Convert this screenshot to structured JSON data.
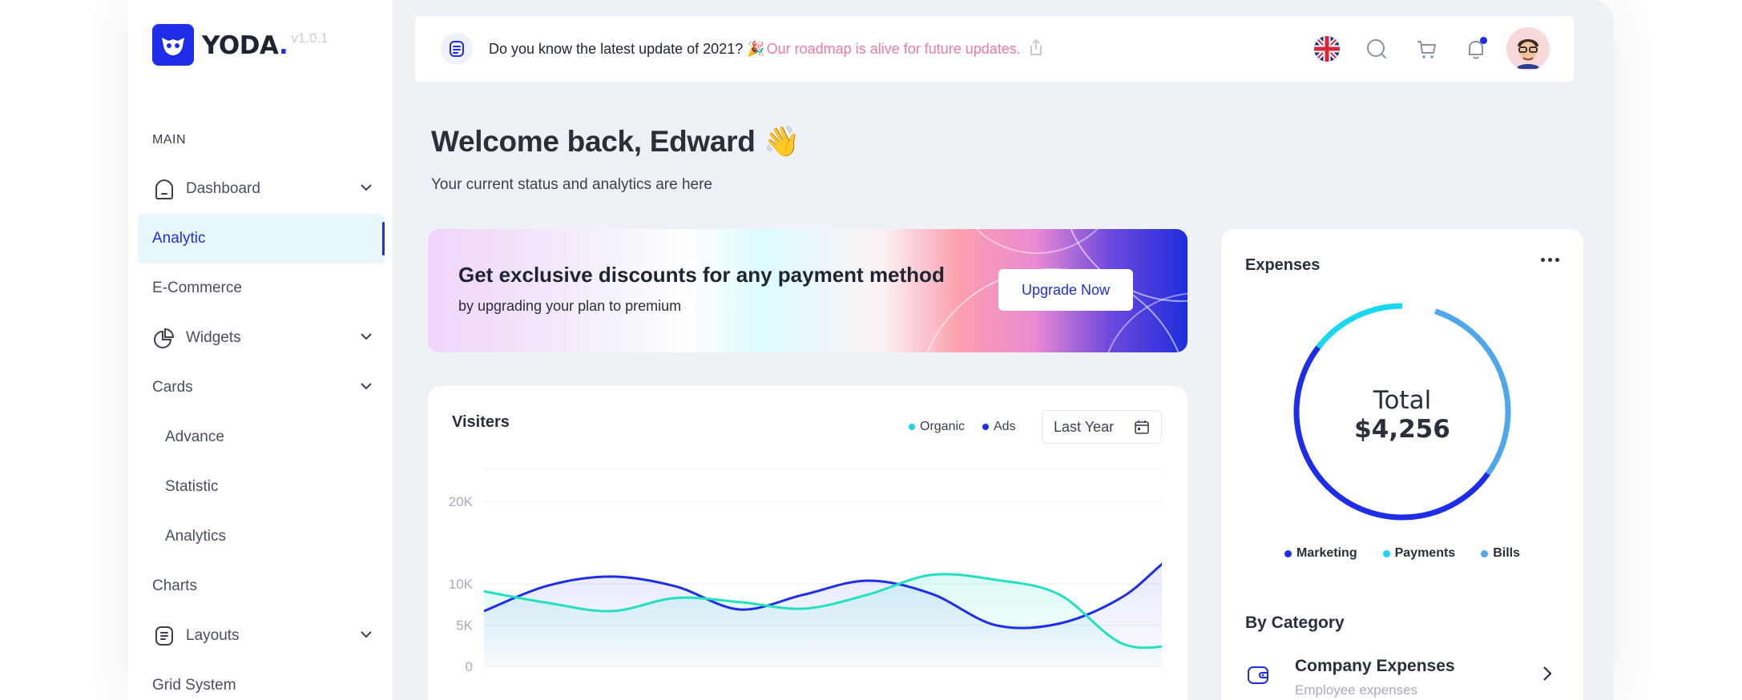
{
  "app": {
    "name": "YODA",
    "name_dot": ".",
    "version": "v1.0.1"
  },
  "sidebar": {
    "section_title": "MAIN",
    "items": [
      {
        "label": "Dashboard",
        "icon": "home-icon",
        "has_chevron": true
      },
      {
        "label": "Analytic",
        "active": true
      },
      {
        "label": "E-Commerce"
      },
      {
        "label": "Widgets",
        "icon": "pie-chart-icon",
        "has_chevron": true
      },
      {
        "label": "Cards",
        "has_chevron": true
      },
      {
        "label": "Advance",
        "sub": true
      },
      {
        "label": "Statistic",
        "sub": true
      },
      {
        "label": "Analytics",
        "sub": true
      },
      {
        "label": "Charts"
      },
      {
        "label": "Layouts",
        "icon": "layout-icon",
        "has_chevron": true
      },
      {
        "label": "Grid System"
      }
    ]
  },
  "topbar": {
    "news_text": "Do you know the latest update of 2021? 🎉",
    "news_link": "Our roadmap is alive for future updates.",
    "icons": [
      "uk-flag-icon",
      "search-icon",
      "cart-icon",
      "bell-icon"
    ],
    "notification_color": "#1e2ee8"
  },
  "welcome": {
    "title": "Welcome back, Edward 👋",
    "subtitle": "Your current status and analytics are here"
  },
  "promo": {
    "title": "Get exclusive discounts for any payment method",
    "subtitle": "by upgrading your plan to premium",
    "button": "Upgrade Now"
  },
  "visitors": {
    "title": "Visiters",
    "legend": [
      {
        "name": "Organic",
        "color": "#1ad7f0"
      },
      {
        "name": "Ads",
        "color": "#1e2ee8"
      }
    ],
    "period": "Last Year"
  },
  "chart_data": {
    "type": "area",
    "ylim": [
      0,
      24000
    ],
    "yticks": [
      0,
      5000,
      10000,
      20000
    ],
    "ytick_labels": [
      "0",
      "5K",
      "10K",
      "20K"
    ],
    "x": [
      0,
      1,
      2,
      3,
      4,
      5,
      6,
      7,
      8,
      9,
      10,
      11,
      12
    ],
    "series": [
      {
        "color": "#1e2ee8",
        "values": [
          6700,
          9800,
          10900,
          9700,
          6900,
          8700,
          10400,
          8800,
          5000,
          5200,
          8500,
          14500,
          14500
        ]
      },
      {
        "color": "#22e0c0",
        "values": [
          9100,
          7700,
          6700,
          8300,
          7800,
          7000,
          8700,
          11100,
          10500,
          8700,
          2700,
          2700,
          2700
        ]
      }
    ],
    "x_range": [
      0,
      10.6
    ]
  },
  "expenses": {
    "title": "Expenses",
    "total_label": "Total",
    "total_value": "$4,256",
    "legend": [
      {
        "name": "Marketing",
        "color": "#1e2ee8"
      },
      {
        "name": "Payments",
        "color": "#1ad7f0"
      },
      {
        "name": "Bills",
        "color": "#4fa7ea"
      }
    ],
    "by_category_title": "By Category",
    "category": {
      "title": "Company Expenses",
      "subtitle": "Employee expenses"
    }
  }
}
